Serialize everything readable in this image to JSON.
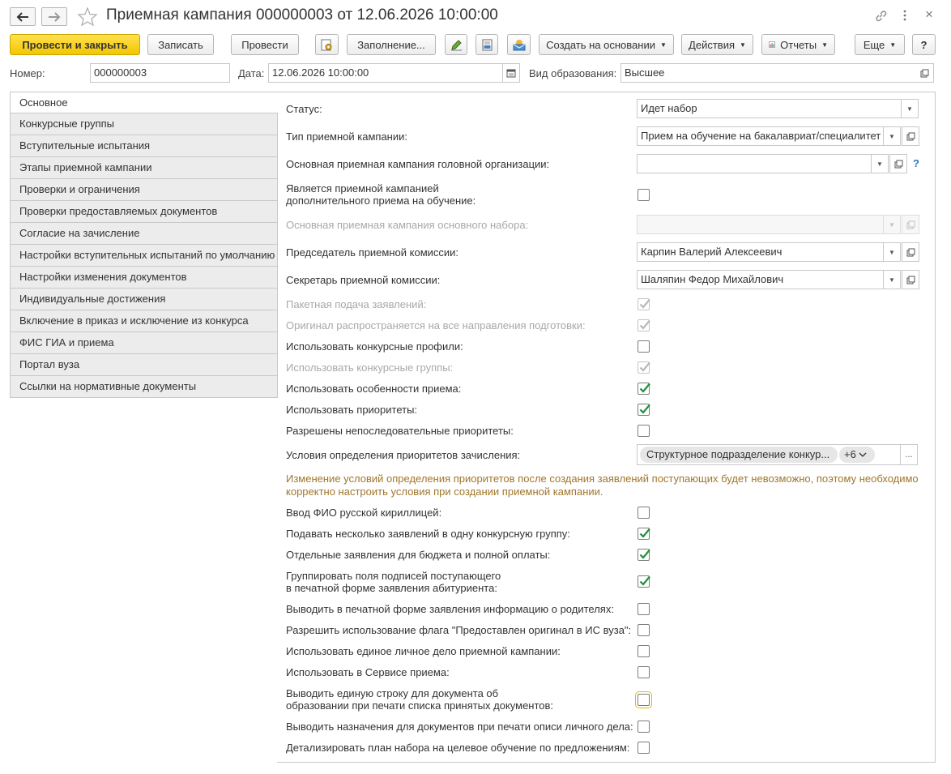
{
  "window": {
    "title": "Приемная кампания 000000003 от 12.06.2026 10:00:00",
    "back_icon": "arrow-left-icon",
    "forward_icon": "arrow-right-icon",
    "star_icon": "star-icon",
    "link_icon": "link-icon",
    "more_icon": "more-vertical-icon",
    "close_label": "×"
  },
  "toolbar": {
    "post_close": "Провести и закрыть",
    "write": "Записать",
    "post": "Провести",
    "fill": "Заполнение...",
    "create_based": "Создать на основании",
    "actions": "Действия",
    "reports": "Отчеты",
    "more": "Еще",
    "help": "?"
  },
  "header": {
    "number_label": "Номер:",
    "number_value": "000000003",
    "date_label": "Дата:",
    "date_value": "12.06.2026 10:00:00",
    "edu_label": "Вид образования:",
    "edu_value": "Высшее"
  },
  "tabs": [
    "Основное",
    "Конкурсные группы",
    "Вступительные испытания",
    "Этапы приемной кампании",
    "Проверки и ограничения",
    "Проверки предоставляемых документов",
    "Согласие на зачисление",
    "Настройки вступительных испытаний по умолчанию",
    "Настройки изменения документов",
    "Индивидуальные достижения",
    "Включение в приказ и исключение из конкурса",
    "ФИС ГИА и приема",
    "Портал вуза",
    "Ссылки на нормативные документы"
  ],
  "fields": {
    "status_label": "Статус:",
    "status_value": "Идет набор",
    "type_label": "Тип приемной кампании:",
    "type_value": "Прием на обучение на бакалавриат/специалитет",
    "head_org_label": "Основная приемная кампания головной организации:",
    "head_org_value": "",
    "help_mark": "?",
    "additional_label_1": "Является приемной кампанией",
    "additional_label_2": "дополнительного приема на обучение:",
    "main_set_label": "Основная приемная кампания основного набора:",
    "chairman_label": "Председатель приемной комиссии:",
    "chairman_value": "Карпин Валерий Алексеевич",
    "secretary_label": "Секретарь приемной комиссии:",
    "secretary_value": "Шаляпин Федор Михайлович",
    "priority_cond_label": "Условия определения приоритетов зачисления:",
    "priority_cond_tag": "Структурное подразделение конкур...",
    "priority_cond_more": "+6",
    "priority_cond_btn": "...",
    "warning": "Изменение условий определения приоритетов после создания заявлений поступающих будет невозможно, поэтому необходимо корректно настроить условия при создании приемной кампании."
  },
  "checkboxes": [
    {
      "label": "Пакетная подача заявлений:",
      "checked": true,
      "disabled": true
    },
    {
      "label": "Оригинал распространяется на все направления подготовки:",
      "checked": true,
      "disabled": true
    },
    {
      "label": "Использовать конкурсные профили:",
      "checked": false,
      "disabled": false
    },
    {
      "label": "Использовать конкурсные группы:",
      "checked": true,
      "disabled": true
    },
    {
      "label": "Использовать особенности приема:",
      "checked": true,
      "disabled": false
    },
    {
      "label": "Использовать приоритеты:",
      "checked": true,
      "disabled": false
    },
    {
      "label": "Разрешены непоследовательные приоритеты:",
      "checked": false,
      "disabled": false
    }
  ],
  "checkboxes2": [
    {
      "label": "Ввод ФИО русской кириллицей:",
      "checked": false
    },
    {
      "label": "Подавать несколько заявлений в одну конкурсную группу:",
      "checked": true
    },
    {
      "label": "Отдельные заявления для бюджета и полной оплаты:",
      "checked": true
    },
    {
      "label1": "Группировать поля подписей поступающего",
      "label2": "в печатной форме заявления абитуриента:",
      "checked": true
    },
    {
      "label": "Выводить в печатной форме заявления информацию о родителях:",
      "checked": false
    },
    {
      "label": "Разрешить использование флага \"Предоставлен оригинал в ИС вуза\":",
      "checked": false
    },
    {
      "label": "Использовать единое личное дело приемной кампании:",
      "checked": false
    },
    {
      "label": "Использовать в Сервисе приема:",
      "checked": false
    },
    {
      "label1": "Выводить единую строку для документа об",
      "label2": "образовании при печати списка принятых документов:",
      "checked": false
    },
    {
      "label": "Выводить назначения для документов при печати описи личного дела:",
      "checked": false
    },
    {
      "label": "Детализировать план набора на целевое обучение по предложениям:",
      "checked": false
    }
  ],
  "colors": {
    "primary_button": "#f3c600",
    "check_green": "#1f8f3a",
    "warning_text": "#a0762b",
    "help_blue": "#2a73c5"
  }
}
